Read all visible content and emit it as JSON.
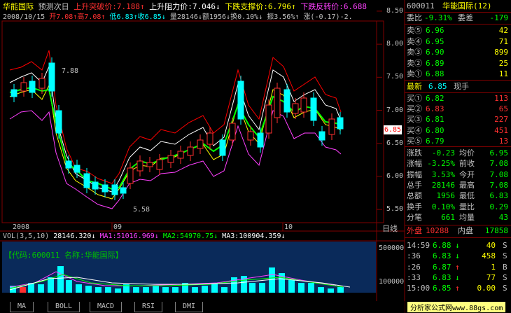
{
  "header": {
    "stock_name": "华能国际",
    "forecast_label": "预测次日",
    "break_up_label": "上升突破价:",
    "break_up_value": "7.188",
    "resist_label": "上升阻力价:",
    "resist_value": "7.046",
    "support_label": "下跌支撑价:",
    "support_value": "6.796",
    "reverse_label": "下跌反转价:",
    "reverse_value": "6.688",
    "date": "2008/10/15",
    "open_label": "开",
    "open_value": "7.08",
    "high_label": "高",
    "high_value": "7.08",
    "low_label": "低",
    "low_value": "6.83",
    "close_label": "收",
    "close_value": "6.85",
    "vol_label": "量",
    "vol_value": "28146",
    "amount_label": "额",
    "amount_value": "1956",
    "turnover_label": "换",
    "turnover_value": "0.10%",
    "amplitude_label": "振",
    "amplitude_value": "3.56%",
    "change_label": "涨",
    "change_value": "(-0.17)-2."
  },
  "price_axis": [
    "8.50",
    "8.00",
    "7.50",
    "7.00",
    "6.50",
    "6.00",
    "5.50"
  ],
  "price_tag": "6.85",
  "annotations": {
    "high": "7.88",
    "low": "5.58"
  },
  "date_axis": [
    "2008",
    "09",
    "10"
  ],
  "period_label": "日线",
  "volume": {
    "label": "VOL(3,5,10)",
    "value": "28146.320",
    "ma1": "MA1:51016.969",
    "ma2": "MA2:54970.75",
    "ma3": "MA3:100904.359",
    "axis_top": "500000",
    "axis_mid": "100000",
    "code_label": "【代码:600011 名称:华能国际】"
  },
  "tabs": [
    "MA",
    "BOLL",
    "MACD",
    "RSI",
    "DMI"
  ],
  "right_panel": {
    "code": "600011",
    "name": "华能国际(12)",
    "weibi_label": "委比",
    "weibi_value": "-9.31%",
    "weicha_label": "委差",
    "weicha_value": "-179",
    "asks": [
      {
        "label": "卖⑤",
        "price": "6.96",
        "vol": "42"
      },
      {
        "label": "卖④",
        "price": "6.95",
        "vol": "71"
      },
      {
        "label": "卖③",
        "price": "6.90",
        "vol": "899"
      },
      {
        "label": "卖②",
        "price": "6.89",
        "vol": "25"
      },
      {
        "label": "卖①",
        "price": "6.88",
        "vol": "11"
      }
    ],
    "latest_label": "最新",
    "latest_value": "6.85",
    "xianshou_label": "现手",
    "bids": [
      {
        "label": "买①",
        "price": "6.82",
        "vol": "113"
      },
      {
        "label": "买②",
        "price": "6.83",
        "vol": "65"
      },
      {
        "label": "买③",
        "price": "6.81",
        "vol": "227"
      },
      {
        "label": "买④",
        "price": "6.80",
        "vol": "451"
      },
      {
        "label": "买⑤",
        "price": "6.79",
        "vol": "13"
      }
    ],
    "stats": [
      {
        "l1": "涨跌",
        "v1": "-0.23",
        "l2": "均价",
        "v2": "6.95"
      },
      {
        "l1": "涨幅",
        "v1": "-3.25%",
        "l2": "前收",
        "v2": "7.08"
      },
      {
        "l1": "振幅",
        "v1": "3.53%",
        "l2": "今开",
        "v2": "7.08"
      },
      {
        "l1": "总手",
        "v1": "28146",
        "l2": "最高",
        "v2": "7.08"
      },
      {
        "l1": "总额",
        "v1": "1956",
        "l2": "最低",
        "v2": "6.83"
      },
      {
        "l1": "换手",
        "v1": "0.10%",
        "l2": "量比",
        "v2": "0.29"
      },
      {
        "l1": "分笔",
        "v1": "661",
        "l2": "均量",
        "v2": "43"
      }
    ],
    "outer_label": "外盘",
    "outer_value": "10288",
    "inner_label": "内盘",
    "inner_value": "17858",
    "ticks": [
      {
        "time": "14:59",
        "price": "6.88",
        "arrow": "↓",
        "vol": "40",
        "flag": "S"
      },
      {
        "time": ":36",
        "price": "6.83",
        "arrow": "↓",
        "vol": "458",
        "flag": "S"
      },
      {
        "time": ":26",
        "price": "6.87",
        "arrow": "↑",
        "vol": "1",
        "flag": "B"
      },
      {
        "time": ":33",
        "price": "6.83",
        "arrow": "↓",
        "vol": "77",
        "flag": "S"
      },
      {
        "time": "15:00",
        "price": "6.85",
        "arrow": "↑",
        "vol": "0.00",
        "flag": "S"
      }
    ]
  },
  "watermark": "分析家公式网www.88gs.com"
}
